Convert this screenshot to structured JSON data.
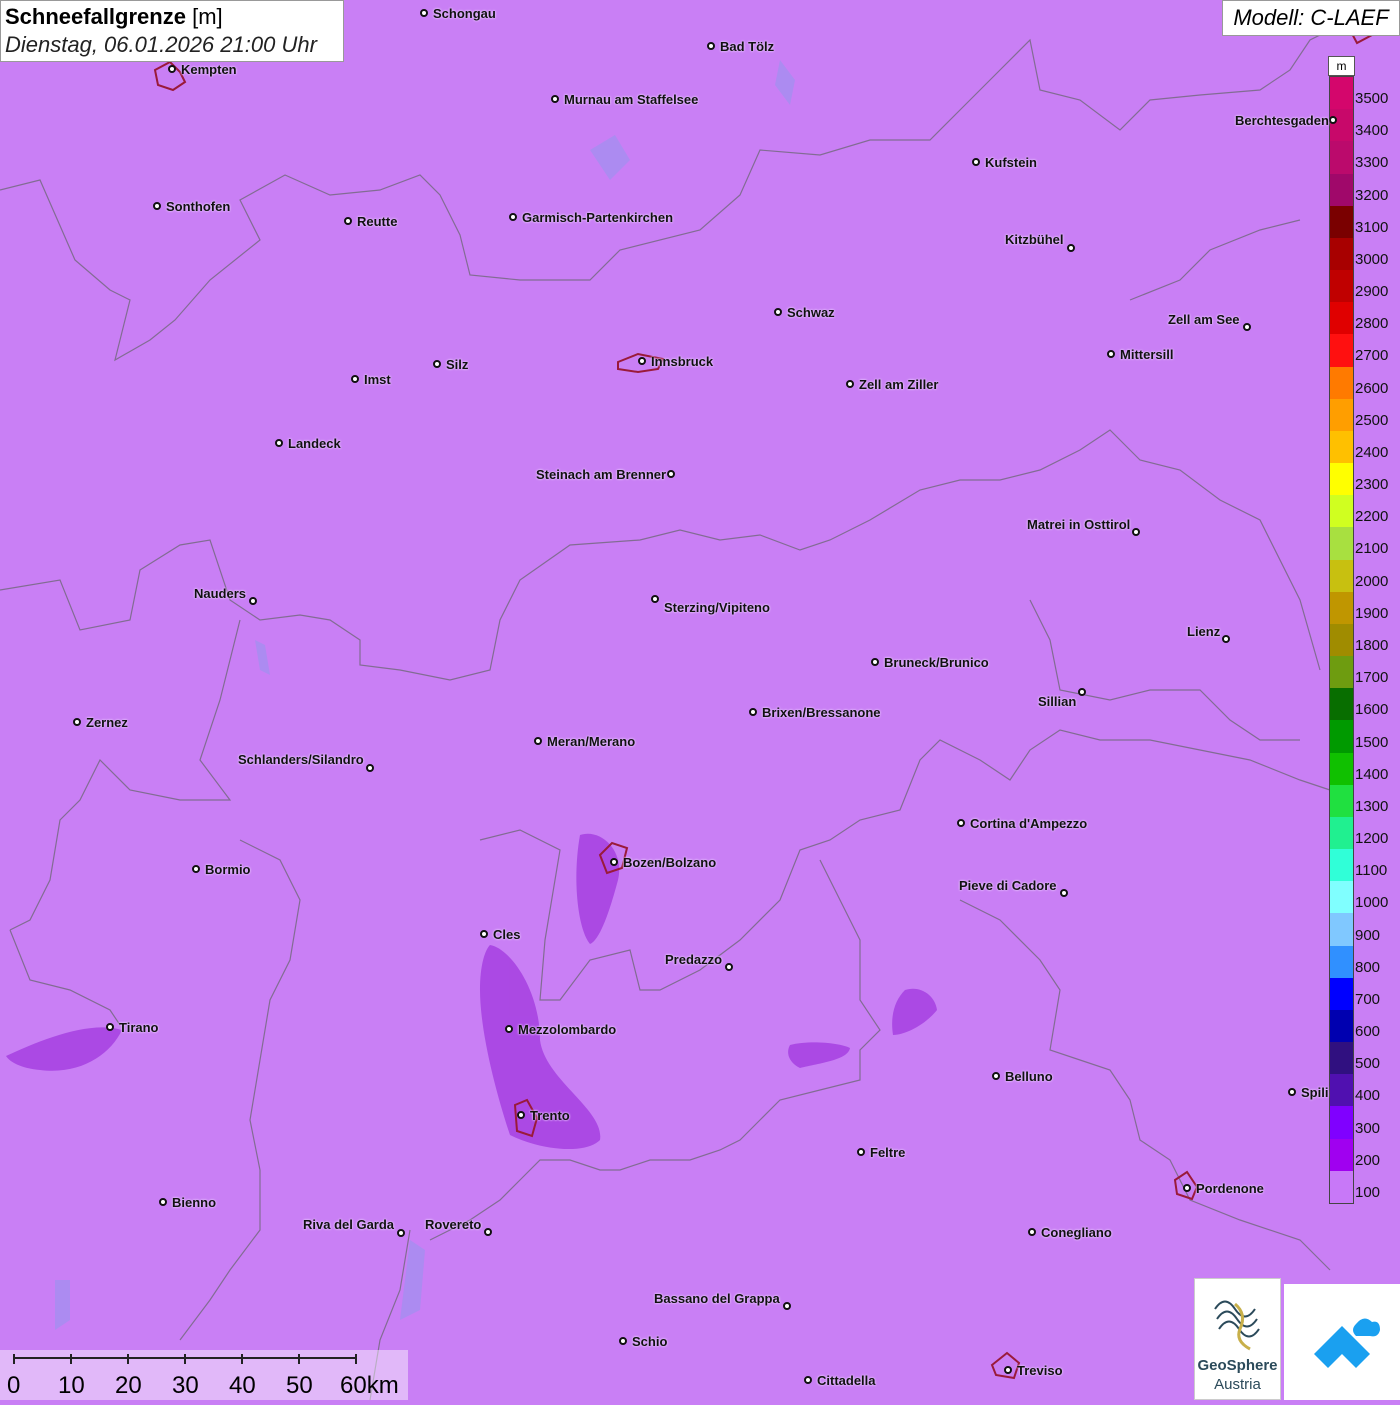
{
  "title": {
    "main": "Schneefallgrenze",
    "unit": "[m]",
    "datetime": "Dienstag, 06.01.2026 21:00 Uhr"
  },
  "model": "Modell: C-LAEF",
  "legend": {
    "unit": "m",
    "labels": [
      "3500",
      "3400",
      "3300",
      "3200",
      "3100",
      "3000",
      "2900",
      "2800",
      "2700",
      "2600",
      "2500",
      "2400",
      "2300",
      "2200",
      "2100",
      "2000",
      "1900",
      "1800",
      "1700",
      "1600",
      "1500",
      "1400",
      "1300",
      "1200",
      "1100",
      "1000",
      "900",
      "800",
      "700",
      "600",
      "500",
      "400",
      "300",
      "200",
      "100"
    ],
    "colors": [
      "#d4066c",
      "#c8086a",
      "#bb0a6c",
      "#a0086a",
      "#7a0000",
      "#a80000",
      "#c00000",
      "#e00000",
      "#ff1010",
      "#ff7a00",
      "#ff9e00",
      "#ffc000",
      "#ffff00",
      "#d0ff20",
      "#a8e040",
      "#c8c010",
      "#c09600",
      "#a08c00",
      "#6e9c10",
      "#086e00",
      "#009a00",
      "#10c000",
      "#20e040",
      "#20f090",
      "#30ffd8",
      "#80ffff",
      "#80c8ff",
      "#3090ff",
      "#0000ff",
      "#0000b0",
      "#301080",
      "#5010b0",
      "#8000ff",
      "#a000f0",
      "#c878f8"
    ]
  },
  "scale": {
    "labels": [
      "0",
      "10",
      "20",
      "30",
      "40",
      "50",
      "60km"
    ]
  },
  "logos": {
    "geosphere_line1": "GeoSphere",
    "geosphere_line2": "Austria"
  },
  "cities": [
    {
      "name": "Schongau"
    },
    {
      "name": "Kempten"
    },
    {
      "name": "Bad Tölz"
    },
    {
      "name": "Murnau am Staffelsee"
    },
    {
      "name": "Berchtesgaden"
    },
    {
      "name": "Kufstein"
    },
    {
      "name": "Sonthofen"
    },
    {
      "name": "Reutte"
    },
    {
      "name": "Garmisch-Partenkirchen"
    },
    {
      "name": "Kitzbühel"
    },
    {
      "name": "Schwaz"
    },
    {
      "name": "Zell am See"
    },
    {
      "name": "Innsbruck"
    },
    {
      "name": "Mittersill"
    },
    {
      "name": "Imst"
    },
    {
      "name": "Silz"
    },
    {
      "name": "Zell am Ziller"
    },
    {
      "name": "Landeck"
    },
    {
      "name": "Steinach am Brenner"
    },
    {
      "name": "Matrei in Osttirol"
    },
    {
      "name": "Nauders"
    },
    {
      "name": "Sterzing/Vipiteno"
    },
    {
      "name": "Lienz"
    },
    {
      "name": "Bruneck/Brunico"
    },
    {
      "name": "Sillian"
    },
    {
      "name": "Zernez"
    },
    {
      "name": "Brixen/Bressanone"
    },
    {
      "name": "Meran/Merano"
    },
    {
      "name": "Schlanders/Silandro"
    },
    {
      "name": "Cortina d'Ampezzo"
    },
    {
      "name": "Bozen/Bolzano"
    },
    {
      "name": "Bormio"
    },
    {
      "name": "Pieve di Cadore"
    },
    {
      "name": "Cles"
    },
    {
      "name": "Predazzo"
    },
    {
      "name": "Tirano"
    },
    {
      "name": "Mezzolombardo"
    },
    {
      "name": "Belluno"
    },
    {
      "name": "Spili"
    },
    {
      "name": "Trento"
    },
    {
      "name": "Feltre"
    },
    {
      "name": "Pordenone"
    },
    {
      "name": "Bienno"
    },
    {
      "name": "Riva del Garda"
    },
    {
      "name": "Rovereto"
    },
    {
      "name": "Conegliano"
    },
    {
      "name": "Bassano del Grappa"
    },
    {
      "name": "Schio"
    },
    {
      "name": "Treviso"
    },
    {
      "name": "Cittadella"
    }
  ]
}
